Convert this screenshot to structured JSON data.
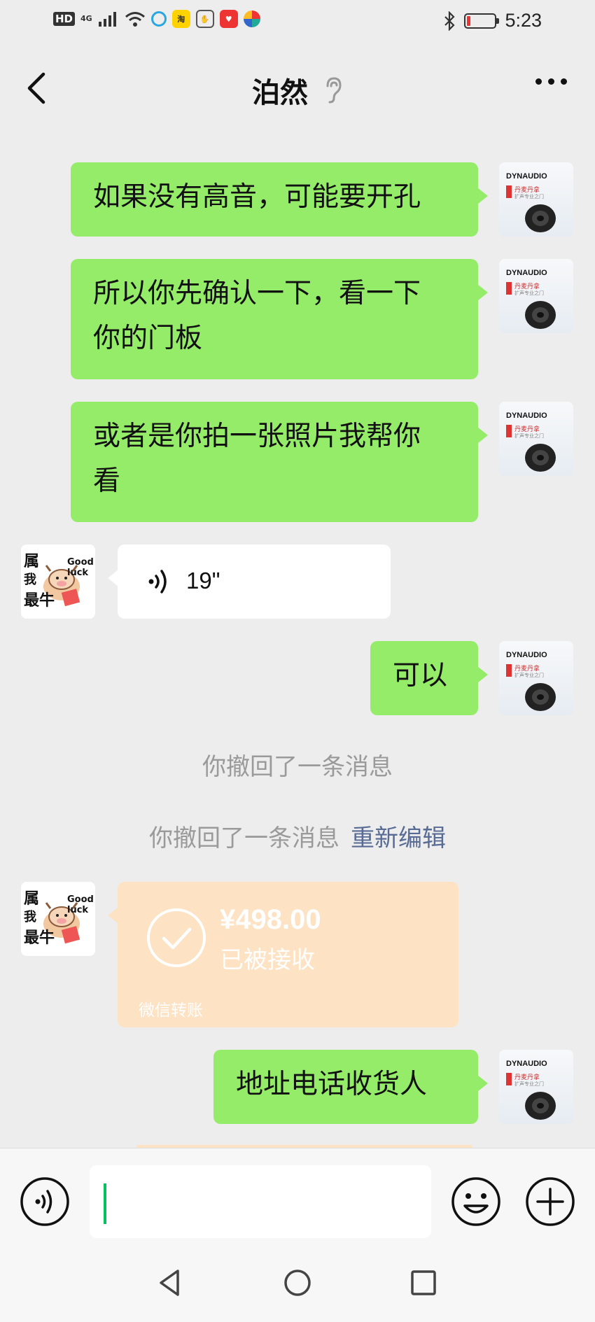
{
  "status_bar": {
    "hd": "HD",
    "network": "4G",
    "time": "5:23",
    "app_icons": [
      "tablet-app-icon",
      "taobao-app-icon",
      "shield-app-icon",
      "heart-app-icon",
      "pinwheel-app-icon"
    ]
  },
  "header": {
    "title": "泊然",
    "back_icon": "chevron-left-icon",
    "status_icon": "ear-icon",
    "more_icon": "more-dots-icon"
  },
  "messages": [
    {
      "side": "right",
      "type": "text",
      "lines": [
        "如果没有高音，可能要开孔"
      ]
    },
    {
      "side": "right",
      "type": "text",
      "lines": [
        "所以你先确认一下，看一下",
        "你的门板"
      ]
    },
    {
      "side": "right",
      "type": "text",
      "lines": [
        "或者是你拍一张照片我帮你",
        "看"
      ]
    },
    {
      "side": "left",
      "type": "voice",
      "duration": "19\""
    },
    {
      "side": "right",
      "type": "text",
      "lines": [
        "可以"
      ]
    },
    {
      "type": "system",
      "text": "你撤回了一条消息"
    },
    {
      "type": "system",
      "text": "你撤回了一条消息",
      "link": "重新编辑"
    },
    {
      "side": "left",
      "type": "transfer",
      "amount": "¥498.00",
      "status": "已被接收",
      "label": "微信转账"
    },
    {
      "side": "right",
      "type": "text",
      "lines": [
        "地址电话收货人"
      ]
    }
  ],
  "avatars": {
    "self": {
      "brand": "DYNAUDIO",
      "subtitle": "丹麦丹拿",
      "tagline": "扩声专业之门"
    },
    "contact": {
      "text_top": "属",
      "text_mid": "我",
      "text_bottom": "最牛",
      "badge": "Good luck"
    }
  },
  "input_bar": {
    "value": "",
    "voice_icon": "voice-input-icon",
    "emoji_icon": "emoji-icon",
    "plus_icon": "plus-icon"
  },
  "nav_bar": {
    "icons": [
      "nav-back-icon",
      "nav-home-icon",
      "nav-recent-icon"
    ]
  },
  "colors": {
    "bubble_self": "#95ec69",
    "bubble_other": "#ffffff",
    "transfer": "#fde2c4",
    "link": "#576b95",
    "system_text": "#9a9a9a",
    "cursor": "#07c160"
  }
}
